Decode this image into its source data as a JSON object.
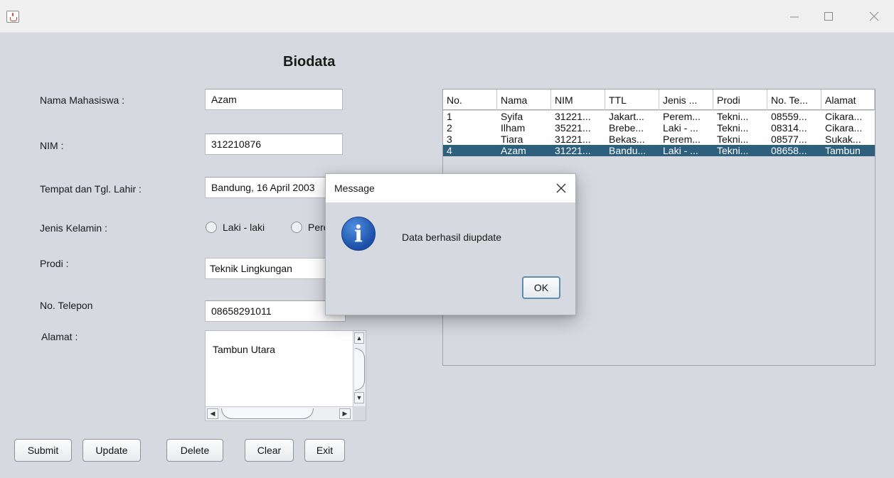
{
  "window": {
    "controls": [
      "minimize",
      "maximize",
      "close"
    ]
  },
  "form": {
    "heading": "Biodata",
    "labels": {
      "nama": "Nama Mahasiswa :",
      "nim": "NIM :",
      "ttl": "Tempat dan Tgl. Lahir :",
      "jk": "Jenis Kelamin :",
      "prodi": "Prodi :",
      "telepon": "No. Telepon",
      "alamat": "Alamat :"
    },
    "values": {
      "nama": "Azam",
      "nim": "312210876",
      "ttl": "Bandung, 16 April 2003",
      "prodi": "Teknik Lingkungan",
      "telepon": "08658291011",
      "alamat": "Tambun Utara"
    },
    "radio": {
      "laki": "Laki - laki",
      "perempuan": "Perempuan"
    }
  },
  "buttons": {
    "submit": "Submit",
    "update": "Update",
    "delete": "Delete",
    "clear": "Clear",
    "exit": "Exit"
  },
  "table": {
    "columns": [
      "No.",
      "Nama",
      "NIM",
      "TTL",
      "Jenis ...",
      "Prodi",
      "No. Te...",
      "Alamat"
    ],
    "rows": [
      [
        "1",
        "Syifa",
        "31221...",
        "Jakart...",
        "Perem...",
        "Tekni...",
        "08559...",
        "Cikara..."
      ],
      [
        "2",
        "Ilham",
        "35221...",
        "Brebe...",
        "Laki - ...",
        "Tekni...",
        "08314...",
        "Cikara..."
      ],
      [
        "3",
        "Tiara",
        "31221...",
        "Bekas...",
        "Perem...",
        "Tekni...",
        "08577...",
        "Sukak..."
      ],
      [
        "4",
        "Azam",
        "31221...",
        "Bandu...",
        "Laki - ...",
        "Tekni...",
        "08658...",
        "Tambun"
      ]
    ],
    "selected_row": 3
  },
  "dialog": {
    "title": "Message",
    "message": "Data berhasil diupdate",
    "ok": "OK",
    "icon": "info-icon"
  }
}
